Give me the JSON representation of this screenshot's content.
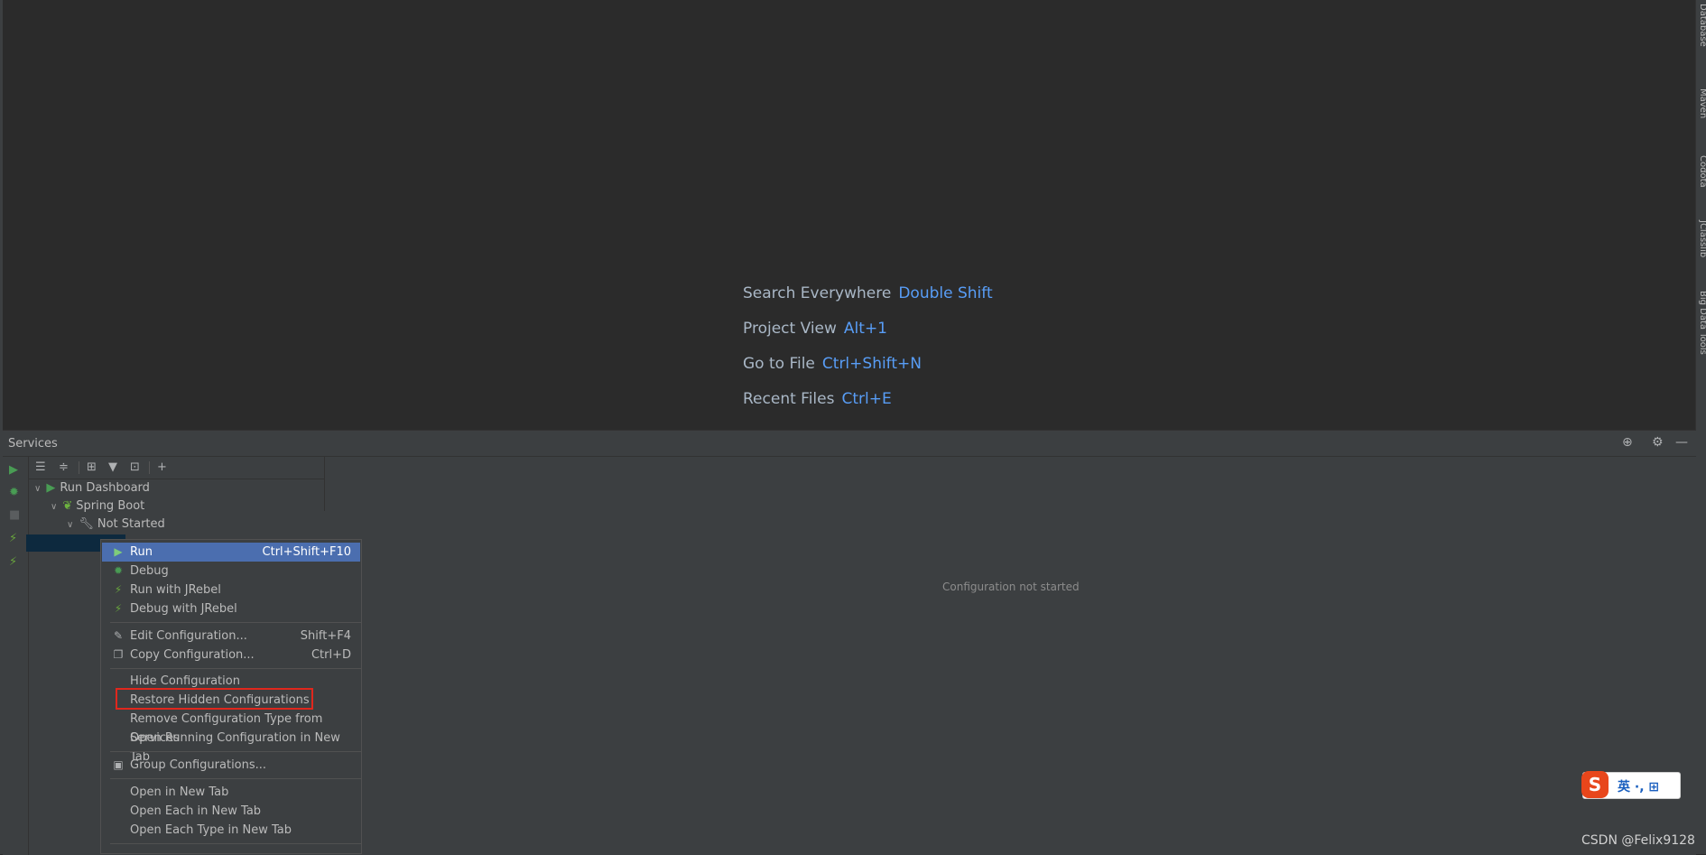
{
  "editor": {
    "hints": [
      {
        "label": "Search Everywhere",
        "key": "Double Shift"
      },
      {
        "label": "Project View",
        "key": "Alt+1"
      },
      {
        "label": "Go to File",
        "key": "Ctrl+Shift+N"
      },
      {
        "label": "Recent Files",
        "key": "Ctrl+E"
      }
    ]
  },
  "right_stripe": {
    "tools": [
      "Database",
      "Maven",
      "Codota",
      "JClasslib",
      "Big Data Tools"
    ]
  },
  "services": {
    "title": "Services",
    "tree": {
      "run_dashboard": "Run Dashboard",
      "spring_boot": "Spring Boot",
      "not_started": "Not Started"
    },
    "detail_message": "Configuration not started"
  },
  "context_menu": {
    "items": [
      {
        "label": "Run",
        "shortcut": "Ctrl+Shift+F10",
        "icon": "play-icon"
      },
      {
        "label": "Debug",
        "shortcut": "",
        "icon": "bug-icon"
      },
      {
        "label": "Run with JRebel",
        "shortcut": "",
        "icon": "jrebel-run-icon"
      },
      {
        "label": "Debug with JRebel",
        "shortcut": "",
        "icon": "jrebel-debug-icon"
      },
      {
        "label": "Edit Configuration...",
        "shortcut": "Shift+F4",
        "icon": "pencil-icon"
      },
      {
        "label": "Copy Configuration...",
        "shortcut": "Ctrl+D",
        "icon": "copy-icon"
      },
      {
        "label": "Hide Configuration",
        "shortcut": "",
        "icon": ""
      },
      {
        "label": "Restore Hidden Configurations",
        "shortcut": "",
        "icon": ""
      },
      {
        "label": "Remove Configuration Type from Services",
        "shortcut": "",
        "icon": ""
      },
      {
        "label": "Open Running Configuration in New Tab",
        "shortcut": "",
        "icon": ""
      },
      {
        "label": "Group Configurations...",
        "shortcut": "",
        "icon": "group-icon"
      },
      {
        "label": "Open in New Tab",
        "shortcut": "",
        "icon": ""
      },
      {
        "label": "Open Each in New Tab",
        "shortcut": "",
        "icon": ""
      },
      {
        "label": "Open Each Type in New Tab",
        "shortcut": "",
        "icon": ""
      }
    ]
  },
  "ime": {
    "logo": "S",
    "text": "英 ·, ⊞"
  },
  "watermark": "CSDN @Felix9128",
  "colors": {
    "accent": "#589df6",
    "selection": "#4b6eaf",
    "highlight_box": "#e0271d"
  }
}
